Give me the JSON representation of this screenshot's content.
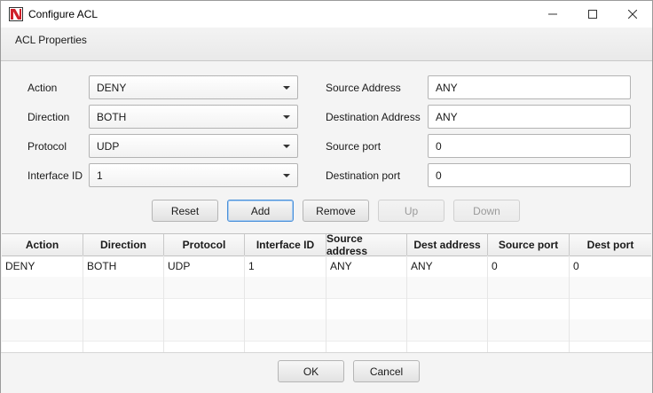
{
  "window": {
    "title": "Configure ACL",
    "icon": "app-logo-icon",
    "controls": [
      "minimize-icon",
      "maximize-icon",
      "close-icon"
    ]
  },
  "header": {
    "label": "ACL Properties"
  },
  "form": {
    "action": {
      "label": "Action",
      "value": "DENY"
    },
    "direction": {
      "label": "Direction",
      "value": "BOTH"
    },
    "protocol": {
      "label": "Protocol",
      "value": "UDP"
    },
    "interface_id": {
      "label": "Interface ID",
      "value": "1"
    },
    "source_address": {
      "label": "Source Address",
      "value": "ANY"
    },
    "destination_address": {
      "label": "Destination Address",
      "value": "ANY"
    },
    "source_port": {
      "label": "Source port",
      "value": "0"
    },
    "destination_port": {
      "label": "Destination port",
      "value": "0"
    }
  },
  "buttons": {
    "reset": "Reset",
    "add": "Add",
    "remove": "Remove",
    "up": "Up",
    "down": "Down"
  },
  "table": {
    "columns": [
      "Action",
      "Direction",
      "Protocol",
      "Interface ID",
      "Source address",
      "Dest address",
      "Source port",
      "Dest port"
    ],
    "rows": [
      [
        "DENY",
        "BOTH",
        "UDP",
        "1",
        "ANY",
        "ANY",
        "0",
        "0"
      ]
    ]
  },
  "footer": {
    "ok": "OK",
    "cancel": "Cancel"
  },
  "colors": {
    "accent": "#4a90d9",
    "logo_red": "#d0202a"
  }
}
